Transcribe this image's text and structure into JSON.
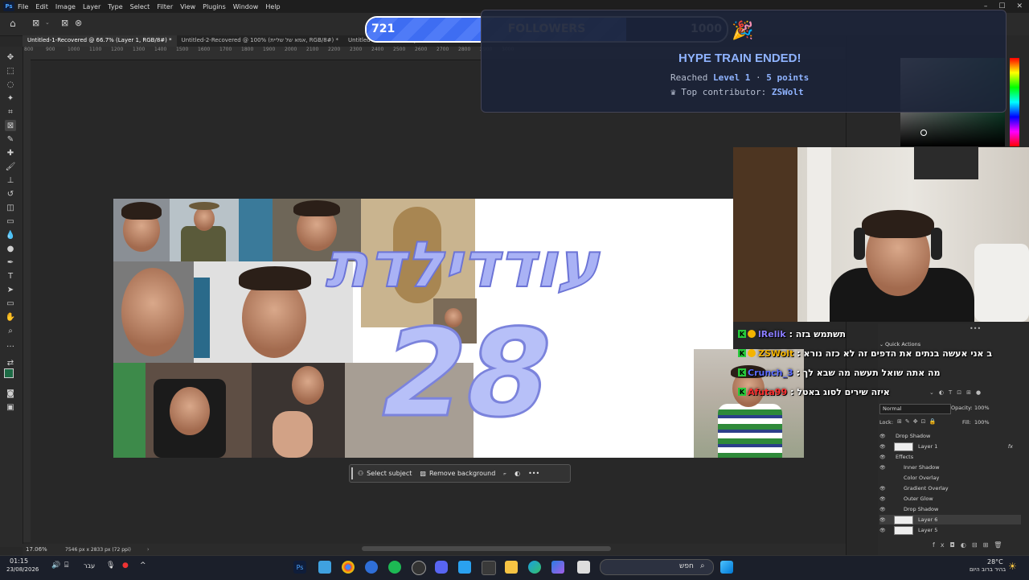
{
  "menubar": {
    "app_logo": "Ps",
    "items": [
      "File",
      "Edit",
      "Image",
      "Layer",
      "Type",
      "Select",
      "Filter",
      "View",
      "Plugins",
      "Window",
      "Help"
    ]
  },
  "tabs": [
    "Untitled-1-Recovered @ 66.7% (Layer 1, RGB/8#) *",
    "Untitled-2-Recovered @ 100% (אמא של שליית, RGB/8#) *",
    "Untitled-1 @ 24.1% (Layer 12, RGB/8#)"
  ],
  "ruler_ticks": [
    "800",
    "900",
    "1000",
    "1100",
    "1200",
    "1300",
    "1400",
    "1500",
    "1600",
    "1700",
    "1800",
    "1900",
    "2000",
    "2100",
    "2200",
    "2300",
    "2400",
    "2500",
    "2600",
    "2700",
    "2800",
    "2900",
    "3000"
  ],
  "followers": {
    "current": "721",
    "label": "FOLLOWERS",
    "goal": "1000",
    "progress": 0.721
  },
  "hype": {
    "title": "HYPE TRAIN ENDED!",
    "reached_prefix": "Reached ",
    "level": "Level 1",
    "sep": " · ",
    "points": "5 points",
    "contrib_prefix": "Top contributor: ",
    "contributor": "ZSWolt"
  },
  "canvas": {
    "title_hebrew": "עודדילדת",
    "title_number": "28"
  },
  "context_bar": {
    "select_subject": "Select subject",
    "remove_background": "Remove background"
  },
  "status": {
    "zoom": "17.06%",
    "doc_info": "7546 px x 2833 px (72 ppi)"
  },
  "chat": [
    {
      "user": "lRelik",
      "message": "תשתמש בזה :",
      "user_color": "#8a7dff"
    },
    {
      "user": "ZSWolt",
      "message": "ב אני אעשה בנתים את הדפים זה לא כזה נורא :",
      "user_color": "#f4b400"
    },
    {
      "user": "Crunch_3",
      "message": "מה אתה שואל תעשה מה שבא לך :",
      "user_color": "#5b6cff"
    },
    {
      "user": "Afuta99",
      "message": "איזה שירים לסוג באטל :",
      "user_color": "#ff3030"
    }
  ],
  "layers_panel": {
    "quick_actions": "Quick Actions",
    "blend_mode": "Normal",
    "opacity_label": "Opacity:",
    "opacity": "100%",
    "lock_label": "Lock:",
    "fill_label": "Fill:",
    "fill": "100%",
    "rows": [
      {
        "label": "Drop Shadow",
        "indent": 1,
        "eye": true
      },
      {
        "label": "Layer 1",
        "indent": 0,
        "eye": true,
        "thumb": true,
        "fx": "fx"
      },
      {
        "label": "Effects",
        "indent": 1,
        "eye": true
      },
      {
        "label": "Inner Shadow",
        "indent": 2,
        "eye": true
      },
      {
        "label": "Color Overlay",
        "indent": 2,
        "eye": false
      },
      {
        "label": "Gradient Overlay",
        "indent": 2,
        "eye": true
      },
      {
        "label": "Outer Glow",
        "indent": 2,
        "eye": true
      },
      {
        "label": "Drop Shadow",
        "indent": 2,
        "eye": true
      },
      {
        "label": "Layer 6",
        "indent": 0,
        "eye": true,
        "thumb": true,
        "selected": true
      },
      {
        "label": "Layer 5",
        "indent": 0,
        "eye": true,
        "thumb": true
      }
    ]
  },
  "taskbar": {
    "time": "01:15",
    "date": "23/08/2026",
    "lang": "עבר",
    "search_placeholder": "חפש",
    "weather_temp": "28°C",
    "weather_desc": "בהיר ברוב היום"
  },
  "colors": {
    "accent": "#3e6df2",
    "chat_badge": "#28c83c",
    "ps_blue": "#4aa3ff"
  }
}
